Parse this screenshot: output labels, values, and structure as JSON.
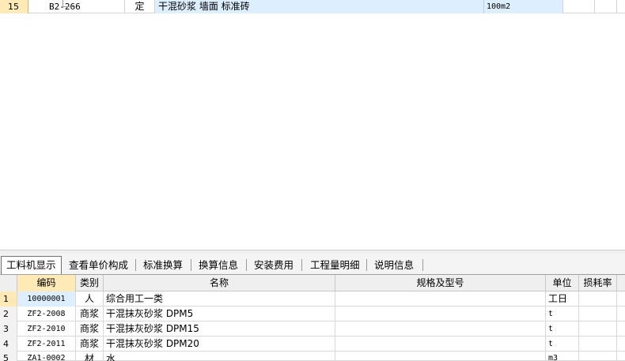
{
  "top_grid": {
    "row": {
      "number": "15",
      "code": "B2-266",
      "type": "定",
      "name": "干混砂浆 墙面 标准砖",
      "unit": "100m2"
    }
  },
  "tabs": [
    {
      "label": "工料机显示",
      "active": true
    },
    {
      "label": "查看单价构成",
      "active": false
    },
    {
      "label": "标准换算",
      "active": false
    },
    {
      "label": "换算信息",
      "active": false
    },
    {
      "label": "安装费用",
      "active": false
    },
    {
      "label": "工程量明细",
      "active": false
    },
    {
      "label": "说明信息",
      "active": false
    }
  ],
  "resource_table": {
    "headers": {
      "code": "编码",
      "type": "类别",
      "name": "名称",
      "spec": "规格及型号",
      "unit": "单位",
      "loss": "损耗率"
    },
    "rows": [
      {
        "idx": "1",
        "code": "10000001",
        "type": "人",
        "name": "综合用工一类",
        "spec": "",
        "unit": "工日",
        "loss": ""
      },
      {
        "idx": "2",
        "code": "ZF2-2008",
        "type": "商浆",
        "name": "干混抹灰砂浆 DPM5",
        "spec": "",
        "unit": "t",
        "loss": ""
      },
      {
        "idx": "3",
        "code": "ZF2-2010",
        "type": "商浆",
        "name": "干混抹灰砂浆 DPM15",
        "spec": "",
        "unit": "t",
        "loss": ""
      },
      {
        "idx": "4",
        "code": "ZF2-2011",
        "type": "商浆",
        "name": "干混抹灰砂浆 DPM20",
        "spec": "",
        "unit": "t",
        "loss": ""
      },
      {
        "idx": "5",
        "code": "ZA1-0002",
        "type": "材",
        "name": "水",
        "spec": "",
        "unit": "m3",
        "loss": ""
      }
    ]
  }
}
